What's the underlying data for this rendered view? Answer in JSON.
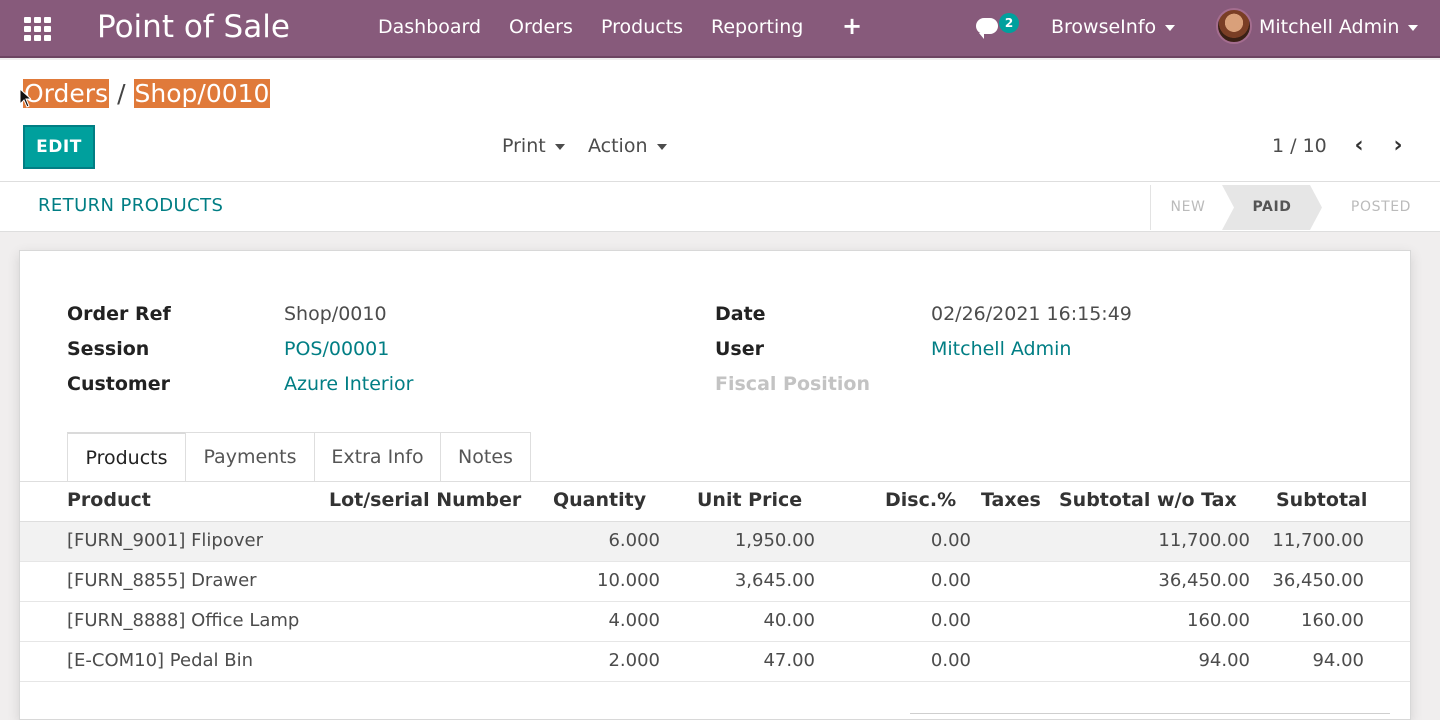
{
  "navbar": {
    "app_title": "Point of Sale",
    "menu": [
      "Dashboard",
      "Orders",
      "Products",
      "Reporting"
    ],
    "add_label": "+",
    "chat_count": "2",
    "company": "BrowseInfo",
    "user": "Mitchell Admin"
  },
  "breadcrumb": {
    "parent": "Orders",
    "current": "Shop/0010"
  },
  "toolbar": {
    "edit_label": "EDIT",
    "print_label": "Print",
    "action_label": "Action",
    "pager": "1 / 10",
    "prev": "‹",
    "next": "›"
  },
  "status": {
    "return_label": "RETURN PRODUCTS",
    "stages": [
      "NEW",
      "PAID",
      "POSTED"
    ],
    "current_stage": "PAID"
  },
  "form": {
    "order_ref_label": "Order Ref",
    "order_ref": "Shop/0010",
    "session_label": "Session",
    "session": "POS/00001",
    "customer_label": "Customer",
    "customer": "Azure Interior",
    "date_label": "Date",
    "date": "02/26/2021 16:15:49",
    "user_label": "User",
    "user": "Mitchell Admin",
    "fiscal_label": "Fiscal Position"
  },
  "tabs": [
    "Products",
    "Payments",
    "Extra Info",
    "Notes"
  ],
  "table": {
    "headers": [
      "Product",
      "Lot/serial Number",
      "Quantity",
      "Unit Price",
      "Disc.%",
      "Taxes",
      "Subtotal w/o Tax",
      "Subtotal"
    ],
    "rows": [
      [
        "[FURN_9001] Flipover",
        "",
        "6.000",
        "1,950.00",
        "0.00",
        "",
        "11,700.00",
        "11,700.00"
      ],
      [
        "[FURN_8855] Drawer",
        "",
        "10.000",
        "3,645.00",
        "0.00",
        "",
        "36,450.00",
        "36,450.00"
      ],
      [
        "[FURN_8888] Office Lamp",
        "",
        "4.000",
        "40.00",
        "0.00",
        "",
        "160.00",
        "160.00"
      ],
      [
        "[E-COM10] Pedal Bin",
        "",
        "2.000",
        "47.00",
        "0.00",
        "",
        "94.00",
        "94.00"
      ]
    ]
  },
  "colors": {
    "navbar": "#875a7b",
    "accent": "#00a09d",
    "link": "#017e84",
    "highlight": "#e07a3a"
  }
}
